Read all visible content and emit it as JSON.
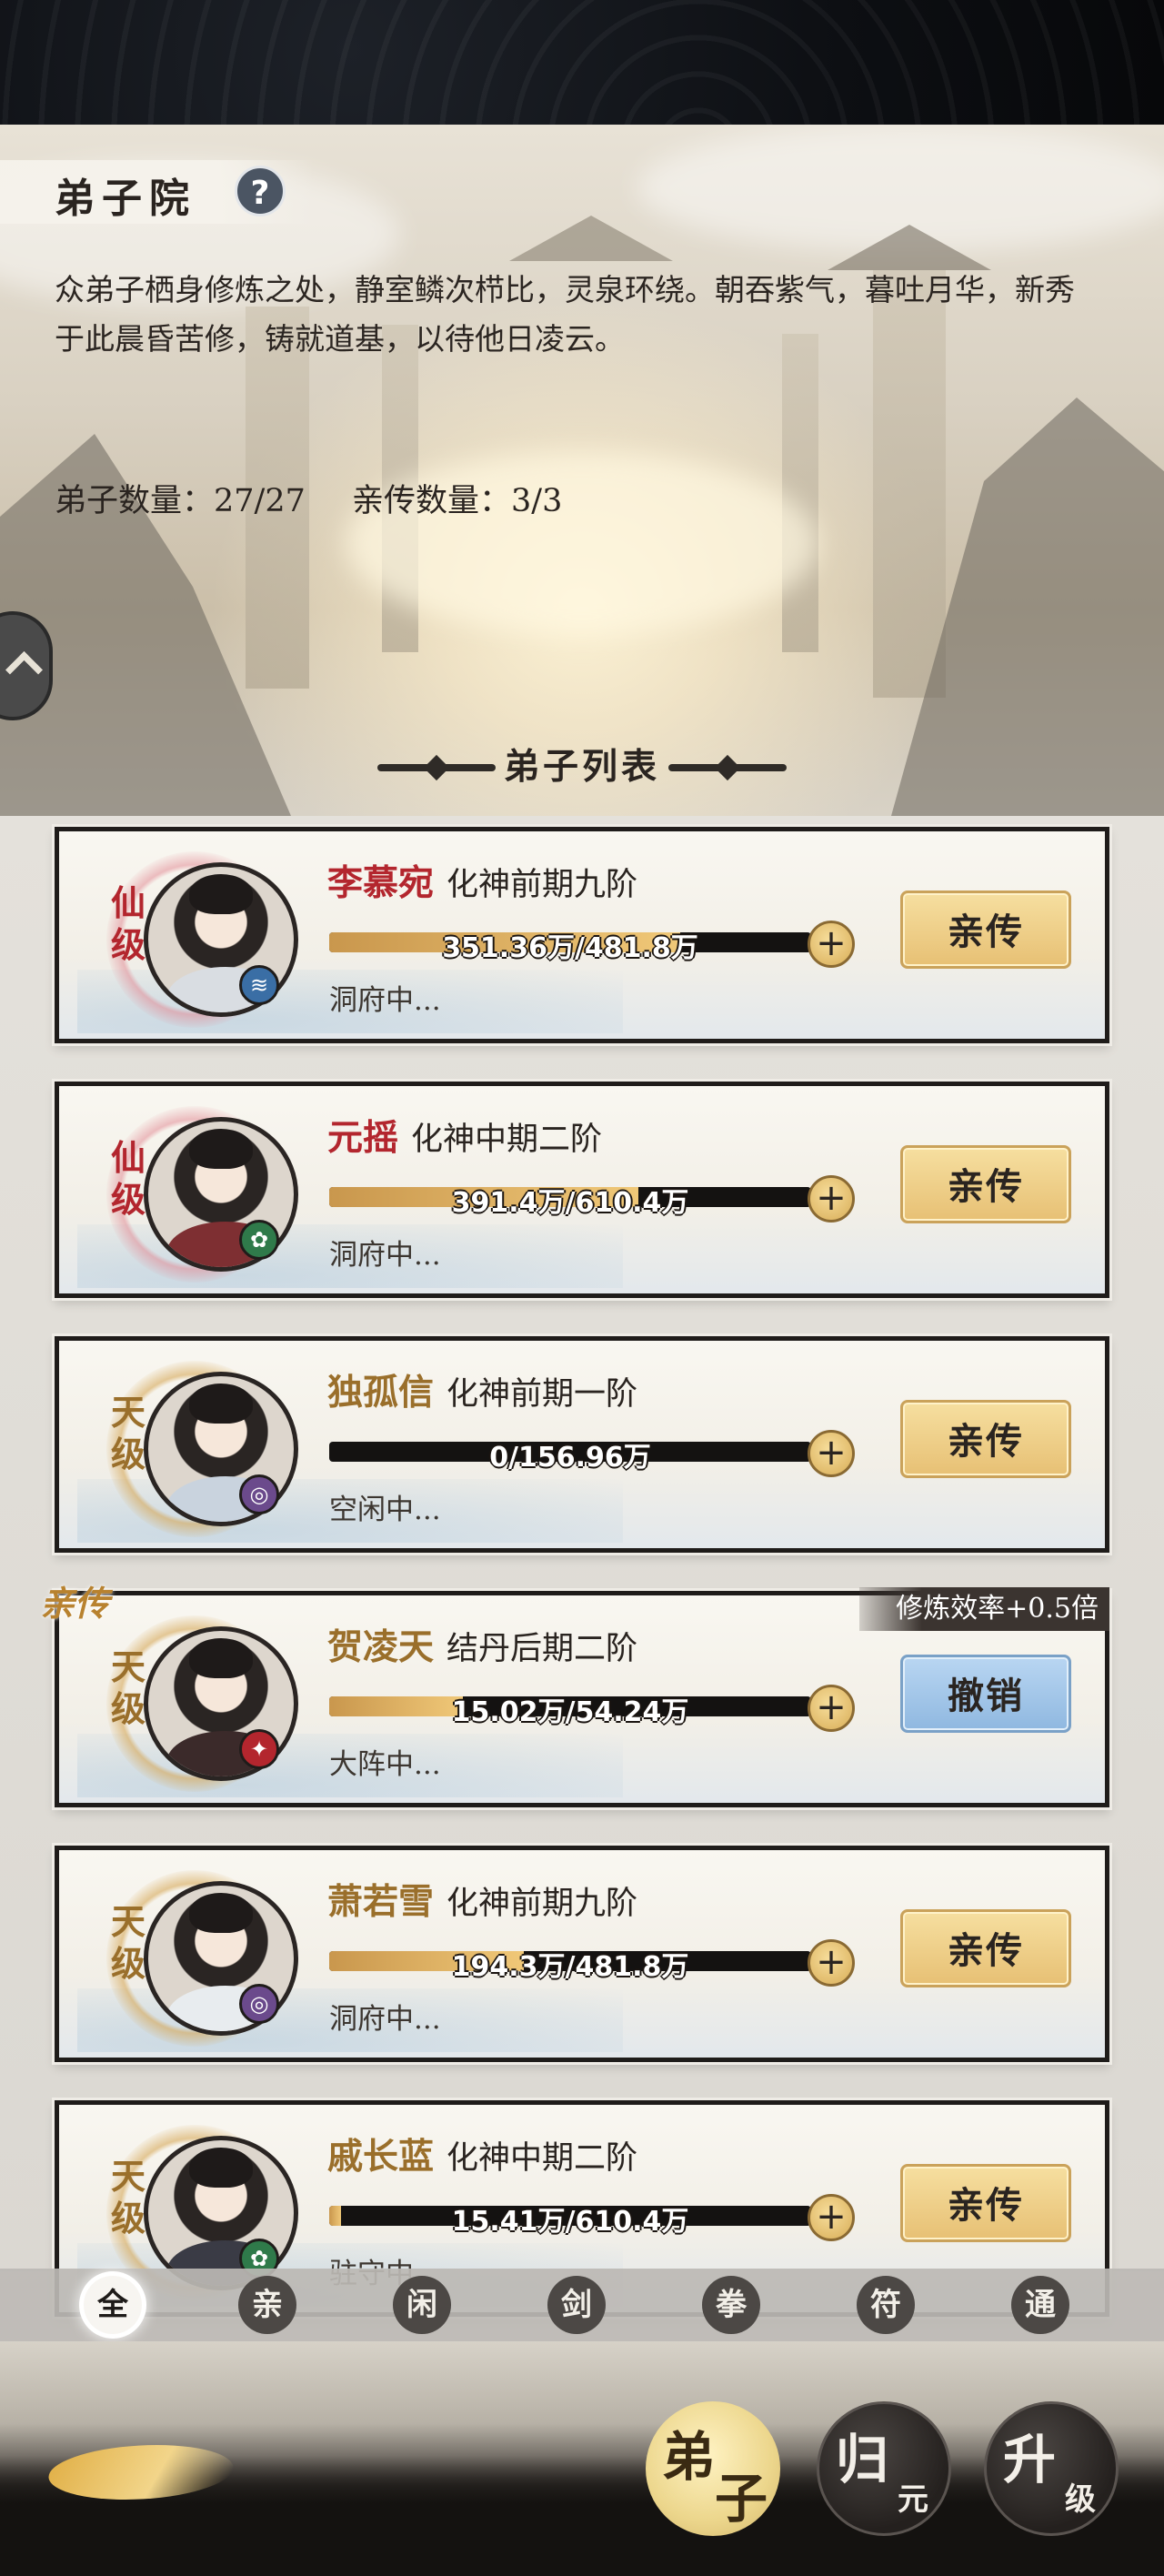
{
  "header": {
    "title": "弟子院",
    "help_label": "?",
    "description": "众弟子栖身修炼之处，静室鳞次栉比，灵泉环绕。朝吞紫气，暮吐月华，新秀于此晨昏苦修，铸就道基，以待他日凌云。",
    "disciple_count": "弟子数量：27/27",
    "direct_count": "亲传数量：3/3"
  },
  "list": {
    "title": "弟子列表",
    "direct_ribbon": "亲传",
    "rate_tag": "修炼效率+0.5倍",
    "disciples": [
      {
        "rank": "仙级",
        "name": "李慕宛",
        "realm": "化神前期九阶",
        "progress_text": "351.36万/481.8万",
        "progress": 0.729,
        "status": "洞府中...",
        "action": "亲传",
        "element": "water"
      },
      {
        "rank": "仙级",
        "name": "元摇",
        "realm": "化神中期二阶",
        "progress_text": "391.4万/610.4万",
        "progress": 0.641,
        "status": "洞府中...",
        "action": "亲传",
        "element": "wood"
      },
      {
        "rank": "天级",
        "name": "独孤信",
        "realm": "化神前期一阶",
        "progress_text": "0/156.96万",
        "progress": 0.0,
        "status": "空闲中...",
        "action": "亲传",
        "element": "wind"
      },
      {
        "rank": "天级",
        "name": "贺凌天",
        "realm": "结丹后期二阶",
        "progress_text": "15.02万/54.24万",
        "progress": 0.277,
        "status": "大阵中...",
        "action": "撤销",
        "element": "fire"
      },
      {
        "rank": "天级",
        "name": "萧若雪",
        "realm": "化神前期九阶",
        "progress_text": "194.3万/481.8万",
        "progress": 0.403,
        "status": "洞府中...",
        "action": "亲传",
        "element": "wind"
      },
      {
        "rank": "天级",
        "name": "戚长蓝",
        "realm": "化神中期二阶",
        "progress_text": "15.41万/610.4万",
        "progress": 0.025,
        "status": "驻守中...",
        "action": "亲传",
        "element": "wood"
      }
    ]
  },
  "filters": [
    "全",
    "亲",
    "闲",
    "剑",
    "拳",
    "符",
    "通"
  ],
  "active_filter": "全",
  "nav": {
    "disciple": {
      "big": "弟",
      "small": "子"
    },
    "return": {
      "big": "归",
      "small": "元"
    },
    "upgrade": {
      "big": "升",
      "small": "级"
    }
  },
  "colors": {
    "xian_rank": "#b3262e",
    "tian_rank": "#9a6f2b",
    "gold_button": "#e7c074",
    "revoke_button": "#8fb8e0"
  }
}
